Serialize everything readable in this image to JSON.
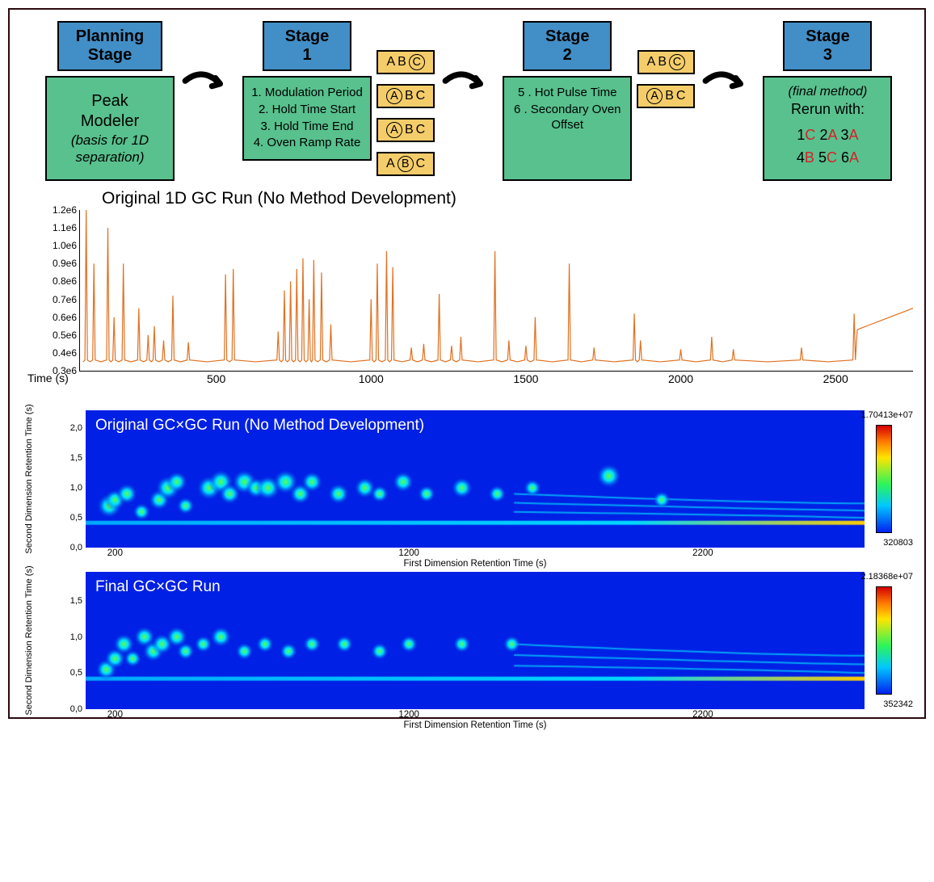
{
  "flow": {
    "stages": {
      "planning": {
        "header": "Planning\nStage",
        "body": "Peak\nModeler",
        "note": "(basis for 1D\nseparation)"
      },
      "s1": {
        "header": "Stage\n1",
        "items": [
          "1.  Modulation Period",
          "2.  Hold Time Start",
          "3.  Hold Time End",
          "4.  Oven Ramp Rate"
        ],
        "choices": [
          {
            "a": "A",
            "b": "B",
            "c": "C",
            "sel": "c"
          },
          {
            "a": "A",
            "b": "B",
            "c": "C",
            "sel": "a"
          },
          {
            "a": "A",
            "b": "B",
            "c": "C",
            "sel": "a"
          },
          {
            "a": "A",
            "b": "B",
            "c": "C",
            "sel": "b"
          }
        ]
      },
      "s2": {
        "header": "Stage\n2",
        "items": [
          "5 .  Hot Pulse Time",
          "6 .  Secondary Oven Offset"
        ],
        "choices": [
          {
            "a": "A",
            "b": "B",
            "c": "C",
            "sel": "c"
          },
          {
            "a": "A",
            "b": "B",
            "c": "C",
            "sel": "a"
          }
        ]
      },
      "s3": {
        "header": "Stage\n3",
        "note": "(final method)",
        "rerun_label": "Rerun with:",
        "selections": [
          {
            "n": "1",
            "v": "C"
          },
          {
            "n": "2",
            "v": "A"
          },
          {
            "n": "3",
            "v": "A"
          },
          {
            "n": "4",
            "v": "B"
          },
          {
            "n": "5",
            "v": "C"
          },
          {
            "n": "6",
            "v": "A"
          }
        ]
      }
    }
  },
  "chart_data": [
    {
      "type": "line",
      "title": "Original 1D GC Run (No Method Development)",
      "xlabel": "Time (s)",
      "ylabel": "",
      "y_ticks": [
        "0.3e6",
        "0.4e6",
        "0.5e6",
        "0.6e6",
        "0.7e6",
        "0.8e6",
        "0.9e6",
        "1.0e6",
        "1.1e6",
        "1.2e6"
      ],
      "x_ticks": [
        "500",
        "1000",
        "1500",
        "2000",
        "2500"
      ],
      "xlim": [
        60,
        2750
      ],
      "ylim": [
        300000,
        1200000
      ],
      "baseline": 350000,
      "peaks": [
        {
          "x": 80,
          "y": 1200000
        },
        {
          "x": 105,
          "y": 900000
        },
        {
          "x": 150,
          "y": 1100000
        },
        {
          "x": 170,
          "y": 600000
        },
        {
          "x": 200,
          "y": 900000
        },
        {
          "x": 250,
          "y": 650000
        },
        {
          "x": 280,
          "y": 500000
        },
        {
          "x": 300,
          "y": 550000
        },
        {
          "x": 330,
          "y": 470000
        },
        {
          "x": 360,
          "y": 720000
        },
        {
          "x": 410,
          "y": 460000
        },
        {
          "x": 530,
          "y": 840000
        },
        {
          "x": 555,
          "y": 870000
        },
        {
          "x": 700,
          "y": 520000
        },
        {
          "x": 720,
          "y": 750000
        },
        {
          "x": 740,
          "y": 800000
        },
        {
          "x": 760,
          "y": 870000
        },
        {
          "x": 780,
          "y": 930000
        },
        {
          "x": 800,
          "y": 700000
        },
        {
          "x": 815,
          "y": 920000
        },
        {
          "x": 840,
          "y": 850000
        },
        {
          "x": 870,
          "y": 560000
        },
        {
          "x": 1000,
          "y": 700000
        },
        {
          "x": 1020,
          "y": 900000
        },
        {
          "x": 1050,
          "y": 970000
        },
        {
          "x": 1070,
          "y": 880000
        },
        {
          "x": 1130,
          "y": 430000
        },
        {
          "x": 1170,
          "y": 450000
        },
        {
          "x": 1220,
          "y": 730000
        },
        {
          "x": 1260,
          "y": 440000
        },
        {
          "x": 1290,
          "y": 490000
        },
        {
          "x": 1400,
          "y": 970000
        },
        {
          "x": 1445,
          "y": 470000
        },
        {
          "x": 1500,
          "y": 440000
        },
        {
          "x": 1530,
          "y": 600000
        },
        {
          "x": 1640,
          "y": 900000
        },
        {
          "x": 1720,
          "y": 430000
        },
        {
          "x": 1850,
          "y": 620000
        },
        {
          "x": 1870,
          "y": 470000
        },
        {
          "x": 2000,
          "y": 420000
        },
        {
          "x": 2100,
          "y": 490000
        },
        {
          "x": 2170,
          "y": 420000
        },
        {
          "x": 2390,
          "y": 430000
        },
        {
          "x": 2560,
          "y": 620000
        }
      ],
      "tail_end_y": 650000
    },
    {
      "type": "heatmap",
      "title": "Original GC×GC Run (No Method Development)",
      "xlabel": "First Dimension Retention Time (s)",
      "ylabel": "Second Dimension Retention Time (s)",
      "x_ticks": [
        "200",
        "1200",
        "2200"
      ],
      "xlim": [
        100,
        2750
      ],
      "y_ticks": [
        "0,0",
        "0,5",
        "1,0",
        "1,5",
        "2,0"
      ],
      "ylim": [
        0,
        2.3
      ],
      "colorbar": {
        "max": "1.70413e+07",
        "min": "320803"
      },
      "blobs": [
        {
          "x": 180,
          "y": 0.7,
          "r": 7
        },
        {
          "x": 200,
          "y": 0.8,
          "r": 6
        },
        {
          "x": 240,
          "y": 0.9,
          "r": 6
        },
        {
          "x": 290,
          "y": 0.6,
          "r": 5
        },
        {
          "x": 350,
          "y": 0.8,
          "r": 6
        },
        {
          "x": 380,
          "y": 1.0,
          "r": 7
        },
        {
          "x": 410,
          "y": 1.1,
          "r": 6
        },
        {
          "x": 440,
          "y": 0.7,
          "r": 5
        },
        {
          "x": 520,
          "y": 1.0,
          "r": 7
        },
        {
          "x": 560,
          "y": 1.1,
          "r": 7
        },
        {
          "x": 590,
          "y": 0.9,
          "r": 6
        },
        {
          "x": 640,
          "y": 1.1,
          "r": 7
        },
        {
          "x": 680,
          "y": 1.0,
          "r": 6
        },
        {
          "x": 720,
          "y": 1.0,
          "r": 7
        },
        {
          "x": 780,
          "y": 1.1,
          "r": 7
        },
        {
          "x": 830,
          "y": 0.9,
          "r": 6
        },
        {
          "x": 870,
          "y": 1.1,
          "r": 6
        },
        {
          "x": 960,
          "y": 0.9,
          "r": 6
        },
        {
          "x": 1050,
          "y": 1.0,
          "r": 6
        },
        {
          "x": 1100,
          "y": 0.9,
          "r": 5
        },
        {
          "x": 1180,
          "y": 1.1,
          "r": 6
        },
        {
          "x": 1260,
          "y": 0.9,
          "r": 5
        },
        {
          "x": 1380,
          "y": 1.0,
          "r": 6
        },
        {
          "x": 1500,
          "y": 0.9,
          "r": 5
        },
        {
          "x": 1620,
          "y": 1.0,
          "r": 5
        },
        {
          "x": 1880,
          "y": 1.2,
          "r": 7
        },
        {
          "x": 2060,
          "y": 0.8,
          "r": 5
        }
      ]
    },
    {
      "type": "heatmap",
      "title": "Final GC×GC Run",
      "xlabel": "First Dimension Retention Time (s)",
      "ylabel": "Second Dimension Retention Time (s)",
      "x_ticks": [
        "200",
        "1200",
        "2200"
      ],
      "xlim": [
        100,
        2750
      ],
      "y_ticks": [
        "0,0",
        "0,5",
        "1,0",
        "1,5"
      ],
      "ylim": [
        0,
        1.9
      ],
      "colorbar": {
        "max": "2.18368e+07",
        "min": "352342"
      },
      "blobs": [
        {
          "x": 170,
          "y": 0.55,
          "r": 6
        },
        {
          "x": 200,
          "y": 0.7,
          "r": 6
        },
        {
          "x": 230,
          "y": 0.9,
          "r": 6
        },
        {
          "x": 260,
          "y": 0.7,
          "r": 5
        },
        {
          "x": 300,
          "y": 1.0,
          "r": 6
        },
        {
          "x": 330,
          "y": 0.8,
          "r": 6
        },
        {
          "x": 360,
          "y": 0.9,
          "r": 6
        },
        {
          "x": 410,
          "y": 1.0,
          "r": 6
        },
        {
          "x": 440,
          "y": 0.8,
          "r": 5
        },
        {
          "x": 500,
          "y": 0.9,
          "r": 5
        },
        {
          "x": 560,
          "y": 1.0,
          "r": 6
        },
        {
          "x": 640,
          "y": 0.8,
          "r": 5
        },
        {
          "x": 710,
          "y": 0.9,
          "r": 5
        },
        {
          "x": 790,
          "y": 0.8,
          "r": 5
        },
        {
          "x": 870,
          "y": 0.9,
          "r": 5
        },
        {
          "x": 980,
          "y": 0.9,
          "r": 5
        },
        {
          "x": 1100,
          "y": 0.8,
          "r": 5
        },
        {
          "x": 1200,
          "y": 0.9,
          "r": 5
        },
        {
          "x": 1380,
          "y": 0.9,
          "r": 5
        },
        {
          "x": 1550,
          "y": 0.9,
          "r": 5
        }
      ]
    }
  ]
}
